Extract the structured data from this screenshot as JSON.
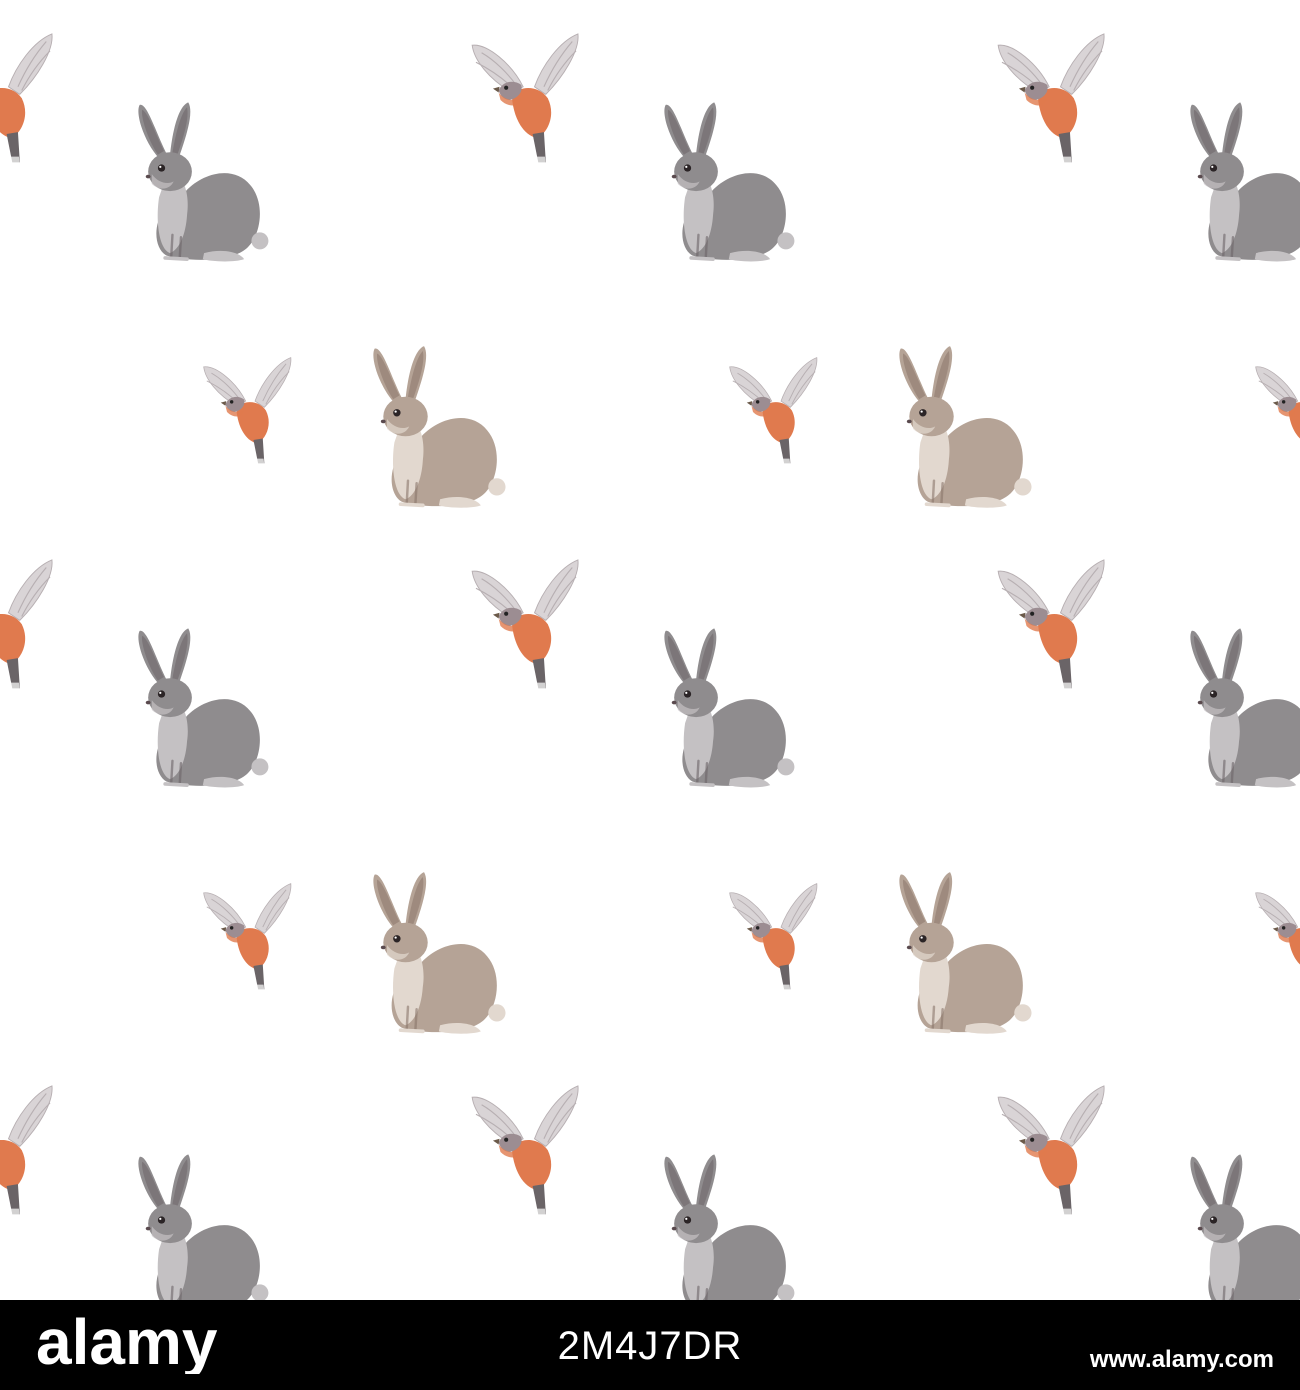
{
  "background_color": "#ffffff",
  "animals": {
    "gray_hare": {
      "name": "gray-hare",
      "body_color": "#8f8c8e",
      "belly_color": "#c4c1c3",
      "ear_inner": "#6d6568"
    },
    "brown_hare": {
      "name": "brown-hare",
      "body_color": "#b5a396",
      "belly_color": "#e2d8cf",
      "ear_inner": "#8b776c"
    },
    "chaffinch": {
      "name": "flying-chaffinch",
      "breast_color": "#e07a4e",
      "wing_color": "#d9d4d6",
      "head_color": "#9c8d92",
      "tail_color": "#6a6467"
    }
  },
  "watermark": {
    "brand": "alamy",
    "image_id": "2M4J7DR",
    "url": "www.alamy.com",
    "bar_color": "#000000",
    "text_color": "#ffffff"
  }
}
